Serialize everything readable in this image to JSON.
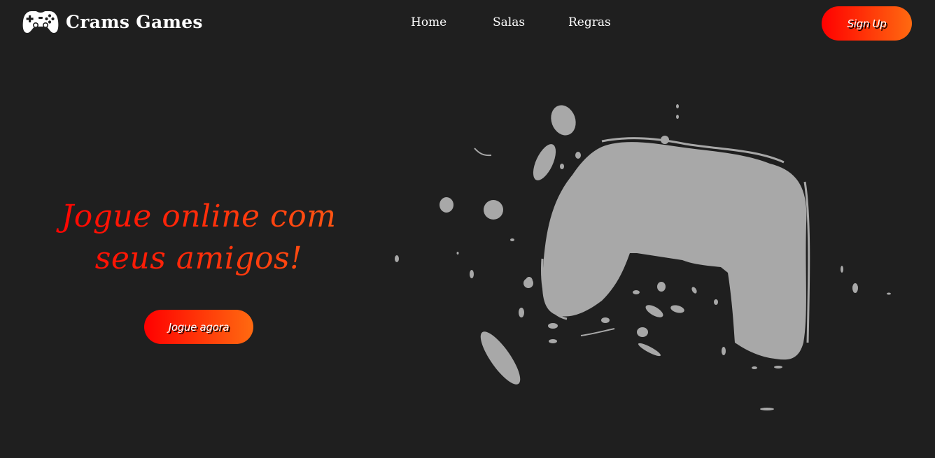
{
  "header": {
    "logo_icon": "gamepad-icon",
    "brand_name": "Crams Games",
    "nav": {
      "home": "Home",
      "salas": "Salas",
      "regras": "Regras"
    },
    "signup_label": "Sign Up"
  },
  "hero": {
    "title": "Jogue online com seus amigos!",
    "cta_label": "Jogue agora",
    "illustration_icon": "gamepad-splash-icon"
  },
  "colors": {
    "background": "#1f1f1f",
    "accent_start": "#ff0000",
    "accent_end": "#ff6a10",
    "illustration": "#a8a8a8"
  }
}
